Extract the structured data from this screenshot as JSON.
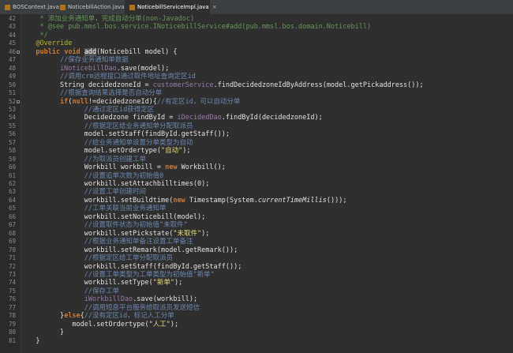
{
  "tabs": [
    {
      "label": "BOSContext.java",
      "active": false
    },
    {
      "label": "NoticebillAction.java",
      "active": false
    },
    {
      "label": "NoticebillServiceImpl.java",
      "active": true
    }
  ],
  "editor": {
    "lines": [
      {
        "n": "42",
        "text": "    * 添加业务通知单，完成自动分单(non-Javadoc)"
      },
      {
        "n": "43",
        "text": "    * @see pub.mmsl.bos.service.INoticebillService#add(pub.mmsl.bos.domain.Noticebill)"
      },
      {
        "n": "44",
        "text": "    */"
      },
      {
        "n": "45",
        "text": "   @Override"
      },
      {
        "n": "46",
        "text": "   public void add(Noticebill model) {"
      },
      {
        "n": "47",
        "text": "         //保存业务通知单数据"
      },
      {
        "n": "48",
        "text": "         iNoticebillDao.save(model);"
      },
      {
        "n": "49",
        "text": "         //调用crm远程接口通过取件地址查询定区id"
      },
      {
        "n": "50",
        "text": "         String decidedzoneId = customerService.findDecidedzoneIdByAddress(model.getPickaddress());"
      },
      {
        "n": "51",
        "text": "         //根据查询结果选择是否自动分单"
      },
      {
        "n": "52",
        "text": "         if(null!=decidedzoneId){//有定区id，可以自动分单"
      },
      {
        "n": "53",
        "text": "               //通过定区id获得定区"
      },
      {
        "n": "54",
        "text": "               Decidedzone findById = iDecidedDao.findById(decidedzoneId);"
      },
      {
        "n": "55",
        "text": "               //根据定区给业务通知单分配取派员"
      },
      {
        "n": "56",
        "text": "               model.setStaff(findById.getStaff());"
      },
      {
        "n": "57",
        "text": "               //给业务通知单设置分单类型为自动"
      },
      {
        "n": "58",
        "text": "               model.setOrdertype(\"自动\");"
      },
      {
        "n": "59",
        "text": "               //为取派员创建工单"
      },
      {
        "n": "60",
        "text": "               Workbill workbill = new Workbill();"
      },
      {
        "n": "61",
        "text": "               //设置追单次数为初始值0"
      },
      {
        "n": "62",
        "text": "               workbill.setAttachbilltimes(0);"
      },
      {
        "n": "63",
        "text": "               //设置工单创建时间"
      },
      {
        "n": "64",
        "text": "               workbill.setBuildtime(new Timestamp(System.currentTimeMillis()));"
      },
      {
        "n": "65",
        "text": "               //工单关联当前业务通知单"
      },
      {
        "n": "66",
        "text": "               workbill.setNoticebill(model);"
      },
      {
        "n": "67",
        "text": "               //设置取件状态为初始值\"未取件\""
      },
      {
        "n": "68",
        "text": "               workbill.setPickstate(\"未取件\");"
      },
      {
        "n": "69",
        "text": "               //根据业务通知单备注设置工单备注"
      },
      {
        "n": "70",
        "text": "               workbill.setRemark(model.getRemark());"
      },
      {
        "n": "71",
        "text": "               //根据定区给工单分配取派员"
      },
      {
        "n": "72",
        "text": "               workbill.setStaff(findById.getStaff());"
      },
      {
        "n": "73",
        "text": "               //设置工单类型为工单类型为初始值\"新单\""
      },
      {
        "n": "74",
        "text": "               workbill.setType(\"新单\");"
      },
      {
        "n": "75",
        "text": "               //保存工单"
      },
      {
        "n": "76",
        "text": "               iWorkbillDao.save(workbill);"
      },
      {
        "n": "77",
        "text": "               //调用短息平台服务给取派员发送短信"
      },
      {
        "n": "78",
        "text": "         }else{//没有定区id，标记人工分单"
      },
      {
        "n": "79",
        "text": "            model.setOrdertype(\"人工\");"
      },
      {
        "n": "80",
        "text": "         }"
      },
      {
        "n": "81",
        "text": "   }"
      }
    ]
  }
}
